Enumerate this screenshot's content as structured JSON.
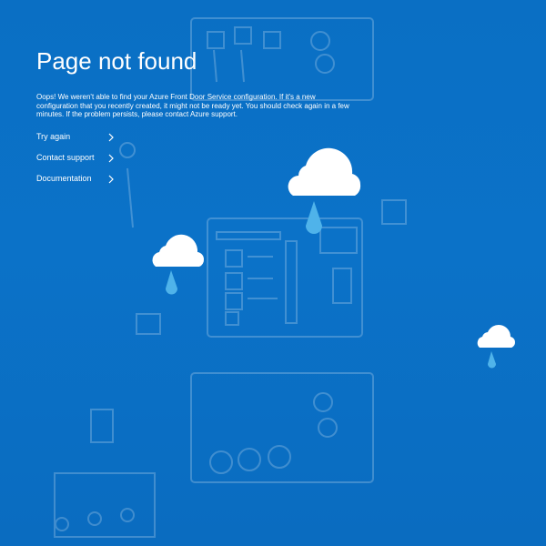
{
  "page": {
    "title": "Page not found",
    "message": "Oops! We weren't able to find your Azure Front Door Service configuration. If it's a new configuration that you recently created, it might not be ready yet. You should check again in a few minutes. If the problem persists, please contact Azure support."
  },
  "links": [
    {
      "label": "Try again",
      "icon": "chevron-right-icon"
    },
    {
      "label": "Contact support",
      "icon": "chevron-right-icon"
    },
    {
      "label": "Documentation",
      "icon": "chevron-right-icon"
    }
  ],
  "colors": {
    "background": "#0b72c8",
    "text": "#ffffff",
    "cloud": "#ffffff",
    "raindrop": "#4fb3ea"
  },
  "icons": [
    "cloud-raindrop-icon",
    "chevron-right-icon"
  ]
}
